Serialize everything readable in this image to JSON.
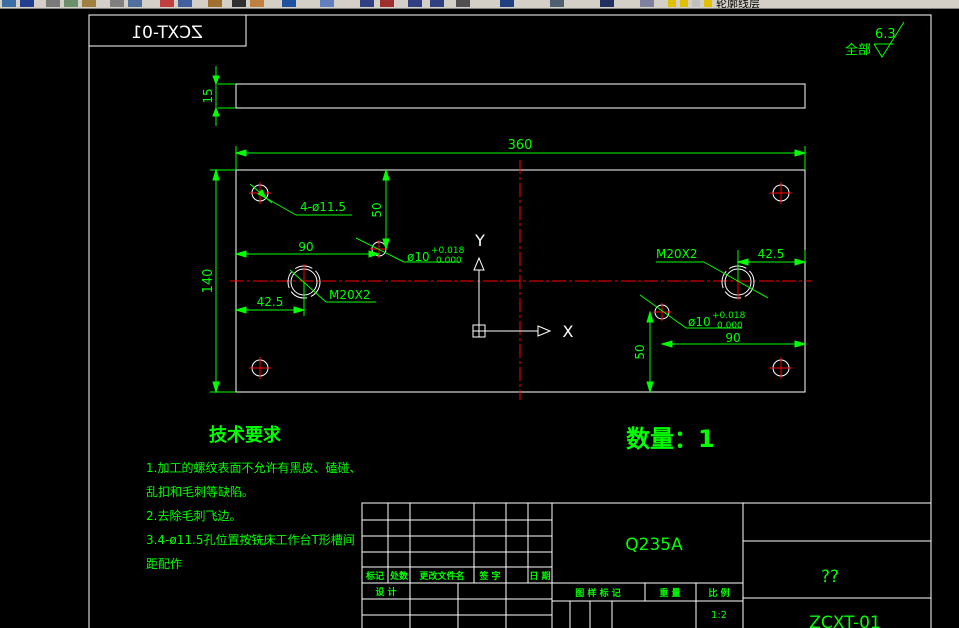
{
  "toolbar": {
    "layer_text": "轮廓线层",
    "icons": [
      "open-icon",
      "save-icon",
      "print-icon",
      "plot-preview-icon",
      "publish-icon",
      "cut-icon",
      "copy-icon",
      "paste-icon",
      "match-properties-icon",
      "undo-icon",
      "redo-icon",
      "hyperlink-icon",
      "pan-icon",
      "zoom-realtime-icon",
      "zoom-window-icon",
      "zoom-previous-icon",
      "properties-icon",
      "design-center-icon",
      "tool-palettes-icon",
      "markup-icon",
      "calculator-icon",
      "layer-manager-icon"
    ]
  },
  "drawing": {
    "mirrored_code": "ZCXT-01",
    "roughness_label": "全部",
    "roughness_value": "6.3",
    "dim_thickness": "15",
    "dim_length": "360",
    "dim_width": "140",
    "dim_holes_note": "4-ø11.5",
    "dim_50_left": "50",
    "dim_90_left": "90",
    "dim_hole10_left": "ø10",
    "dim_tol_upper": "+0.018",
    "dim_tol_lower": "0.000",
    "dim_m20_left": "M20X2",
    "dim_42_left": "42.5",
    "dim_m20_right": "M20X2",
    "dim_42_right": "42.5",
    "dim_hole10_right": "ø10",
    "dim_90_right": "90",
    "dim_50_right": "50",
    "axis_y": "Y",
    "axis_x": "X",
    "tech_title": "技术要求",
    "tech_lines": [
      "1.加工的螺纹表面不允许有黑皮、磕碰、",
      "乱扣和毛刺等缺陷。",
      "2.去除毛刺飞边。",
      "3.4-ø11.5孔位置按铣床工作台T形槽间",
      "距配作"
    ],
    "quantity": "数量：1",
    "title_block": {
      "material": "Q235A",
      "part_name": "??",
      "drawing_code": "ZCXT-01",
      "scale": "1:2",
      "col_mark": "标记",
      "col_count": "处数",
      "col_doc": "更改文件名",
      "col_sign": "签 字",
      "col_date": "日 期",
      "design": "设 计",
      "stage_mark": "图 样 标 记",
      "weight": "重 量",
      "ratio": "比 例"
    }
  },
  "colors": {
    "background": "#000000",
    "outline": "#ffffff",
    "dimension": "#00ff00",
    "center_line": "#ff0000",
    "toolbar": "#d4d0c8"
  }
}
